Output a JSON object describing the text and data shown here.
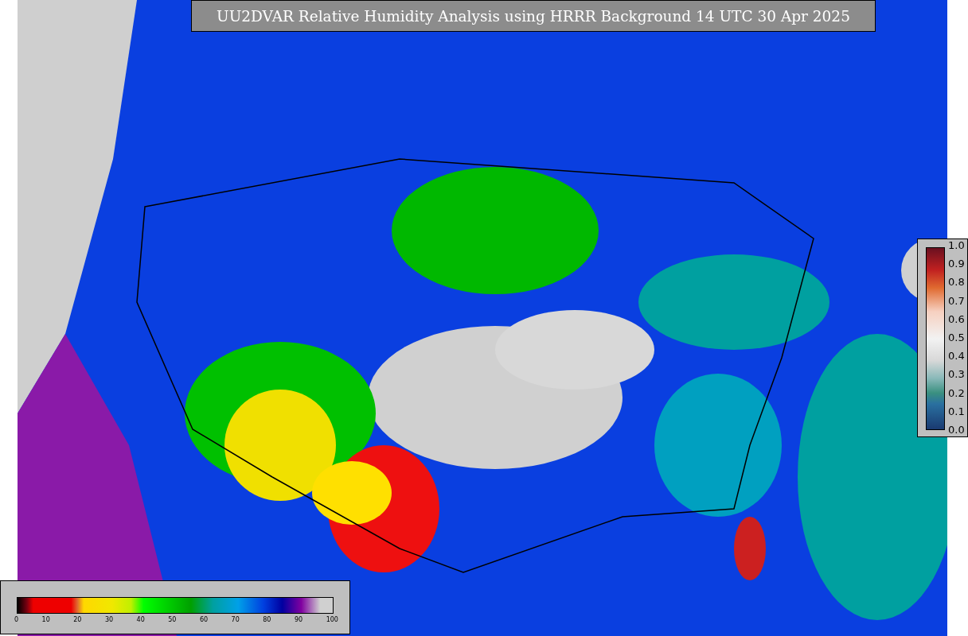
{
  "title": "UU2DVAR Relative Humidity Analysis using HRRR Background 14 UTC 30 Apr 2025",
  "humidity_colorbar": {
    "ticks": [
      "0",
      "10",
      "20",
      "30",
      "40",
      "50",
      "60",
      "70",
      "80",
      "90",
      "100"
    ]
  },
  "ratio_colorbar": {
    "ticks": [
      "1.0",
      "0.9",
      "0.8",
      "0.7",
      "0.6",
      "0.5",
      "0.4",
      "0.3",
      "0.2",
      "0.1",
      "0.0"
    ]
  }
}
